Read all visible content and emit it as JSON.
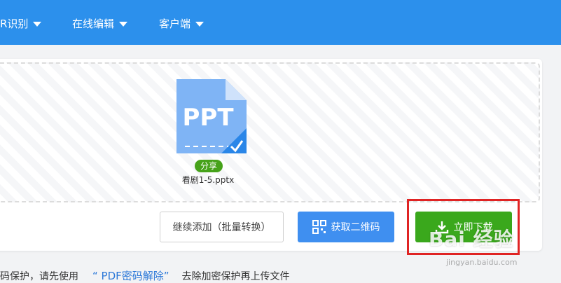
{
  "header": {
    "nav": [
      {
        "label": "R识别"
      },
      {
        "label": "在线编辑"
      },
      {
        "label": "客户端"
      }
    ]
  },
  "file": {
    "type_label": "PPT",
    "name": "看剧1-5.pptx",
    "share_label": "分享"
  },
  "actions": {
    "continue_label": "继续添加（批量转换）",
    "qr_label": "获取二维码",
    "download_label": "立即下载"
  },
  "notice": {
    "prefix": "码保护，请先使用",
    "link": "“ PDF密码解除”",
    "suffix": "去除加密保护再上传文件"
  },
  "watermark": {
    "text": "Bai 经验",
    "url": "jingyan.baidu.com"
  },
  "colors": {
    "topbar": "#2c90ec",
    "download": "#3aa81c",
    "qr": "#3f8ff0",
    "highlight": "#e02424"
  }
}
